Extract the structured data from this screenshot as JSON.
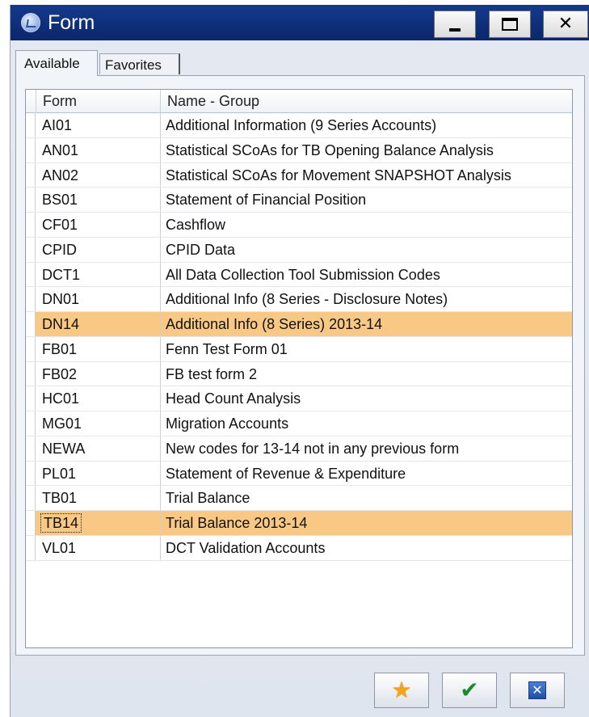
{
  "window": {
    "title": "Form",
    "controls": {
      "minimize": "_",
      "maximize": "□",
      "close": "✕"
    }
  },
  "tabs": [
    {
      "label": "Available",
      "active": true
    },
    {
      "label": "Favorites",
      "active": false
    }
  ],
  "grid": {
    "columns": [
      "Form",
      "Name - Group"
    ],
    "rows": [
      {
        "form": "AI01",
        "name": "Additional Information (9 Series Accounts)"
      },
      {
        "form": "AN01",
        "name": "Statistical SCoAs for TB Opening Balance Analysis"
      },
      {
        "form": "AN02",
        "name": "Statistical SCoAs for Movement SNAPSHOT Analysis"
      },
      {
        "form": "BS01",
        "name": "Statement of Financial Position"
      },
      {
        "form": "CF01",
        "name": "Cashflow"
      },
      {
        "form": "CPID",
        "name": "CPID Data"
      },
      {
        "form": "DCT1",
        "name": "All Data Collection Tool Submission Codes"
      },
      {
        "form": "DN01",
        "name": "Additional Info (8 Series - Disclosure Notes)"
      },
      {
        "form": "DN14",
        "name": "Additional Info (8 Series) 2013-14",
        "selected": true
      },
      {
        "form": "FB01",
        "name": "Fenn Test Form 01"
      },
      {
        "form": "FB02",
        "name": "FB test form 2"
      },
      {
        "form": "HC01",
        "name": "Head Count Analysis"
      },
      {
        "form": "MG01",
        "name": "Migration Accounts"
      },
      {
        "form": "NEWA",
        "name": "New codes for 13-14 not in any previous form"
      },
      {
        "form": "PL01",
        "name": "Statement of Revenue & Expenditure"
      },
      {
        "form": "TB01",
        "name": "Trial Balance"
      },
      {
        "form": "TB14",
        "name": "Trial Balance 2013-14",
        "selected": true,
        "focused": true
      },
      {
        "form": "VL01",
        "name": "DCT Validation Accounts"
      }
    ]
  },
  "footer": {
    "buttons": [
      {
        "name": "add-favorite-button",
        "icon": "star-icon"
      },
      {
        "name": "ok-button",
        "icon": "check-icon"
      },
      {
        "name": "cancel-button",
        "icon": "cancel-icon"
      }
    ]
  },
  "colors": {
    "titlebar": "#0f2f7b",
    "selected_row": "#f8c884",
    "star": "#f3a41b",
    "check": "#1e8a2e",
    "cancel": "#1f4fa8"
  }
}
